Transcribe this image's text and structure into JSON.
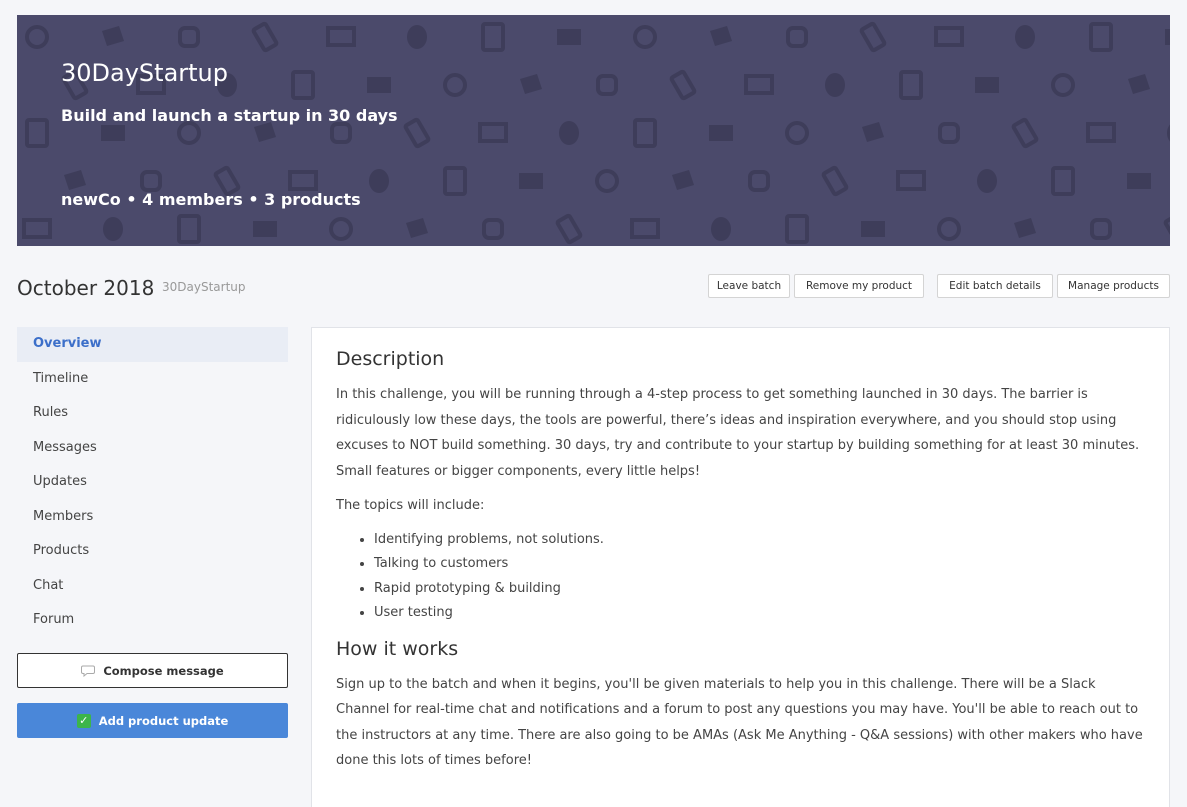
{
  "hero": {
    "title": "30DayStartup",
    "subtitle": "Build and launch a startup in 30 days",
    "meta": "newCo • 4 members • 3 products",
    "bg_color": "#4b4a6b"
  },
  "batch": {
    "title": "October 2018",
    "tag": "30DayStartup"
  },
  "actions": {
    "leave": "Leave batch",
    "remove": "Remove my product",
    "edit": "Edit batch details",
    "manage": "Manage products"
  },
  "sidebar": {
    "items": [
      {
        "label": "Overview",
        "active": true
      },
      {
        "label": "Timeline"
      },
      {
        "label": "Rules"
      },
      {
        "label": "Messages"
      },
      {
        "label": "Updates"
      },
      {
        "label": "Members"
      },
      {
        "label": "Products"
      },
      {
        "label": "Chat"
      },
      {
        "label": "Forum"
      }
    ],
    "compose_label": "Compose message",
    "compose_icon": "speech-bubble-icon",
    "update_label": "Add product update",
    "update_icon": "checkbox-icon",
    "accent": "#4a87d9"
  },
  "content": {
    "description_heading": "Description",
    "description_text": "In this challenge, you will be running through a 4-step process to get something launched in 30 days. The barrier is ridiculously low these days, the tools are powerful, there’s ideas and inspiration everywhere, and you should stop using excuses to NOT build something. 30 days, try and contribute to your startup by building something for at least 30 minutes. Small features or bigger components, every little helps!",
    "topics_intro": "The topics will include:",
    "topics": [
      "Identifying problems, not solutions.",
      "Talking to customers",
      "Rapid prototyping & building",
      "User testing"
    ],
    "how_heading": "How it works",
    "how_text": "Sign up to the batch and when it begins, you'll be given materials to help you in this challenge. There will be a Slack Channel for real-time chat and notifications and a forum to post any questions you may have. You'll be able to reach out to the instructors at any time. There are also going to be AMAs (Ask Me Anything - Q&A sessions) with other makers who have done this lots of times before!"
  }
}
